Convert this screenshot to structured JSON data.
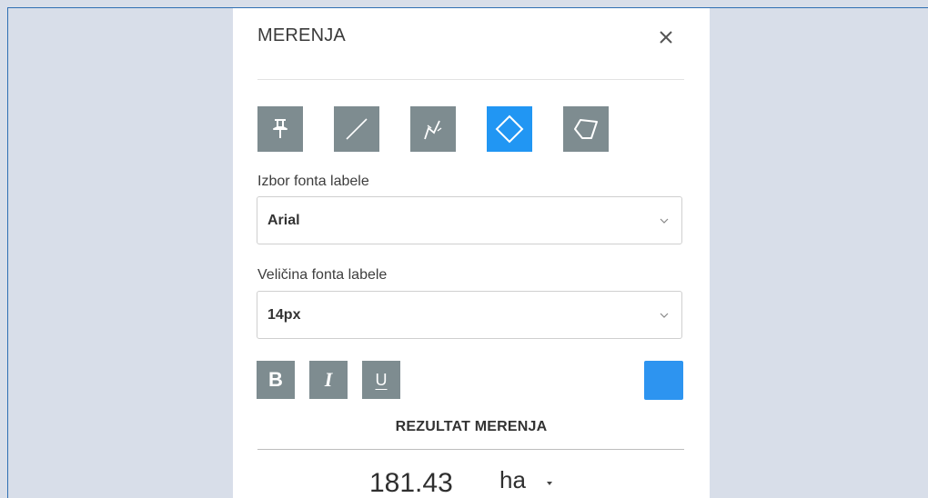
{
  "panel": {
    "title": "MERENJA",
    "close_icon": "close-icon"
  },
  "tools": [
    {
      "name": "pin-tool",
      "icon": "pushpin-icon",
      "active": false
    },
    {
      "name": "line-tool",
      "icon": "line-icon",
      "active": false
    },
    {
      "name": "polyline-tool",
      "icon": "polyline-icon",
      "active": false
    },
    {
      "name": "rectangle-area-tool",
      "icon": "diamond-icon",
      "active": true
    },
    {
      "name": "polygon-area-tool",
      "icon": "polygon-icon",
      "active": false
    }
  ],
  "font_select": {
    "label": "Izbor fonta labele",
    "value": "Arial"
  },
  "size_select": {
    "label": "Veličina fonta labele",
    "value": "14px"
  },
  "format": {
    "bold": "B",
    "italic": "I",
    "underline": "U",
    "color": "#2d94f0"
  },
  "result": {
    "title": "REZULTAT MERENJA",
    "value": "181.43",
    "unit": "ha"
  },
  "colors": {
    "accent": "#2196f3",
    "tool_bg": "#7e8c90",
    "background": "#d8dee9"
  }
}
